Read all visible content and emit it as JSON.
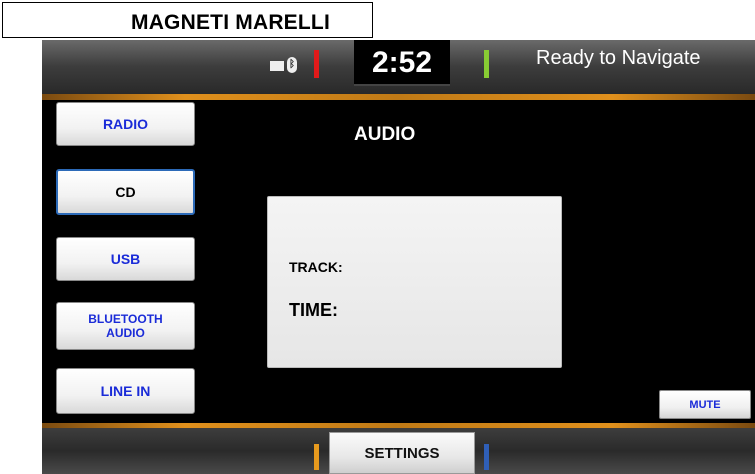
{
  "brand": {
    "name": "MAGNETI MARELLI"
  },
  "status_bar": {
    "clock": "2:52",
    "nav_status": "Ready to Navigate",
    "icons": [
      "mail-icon",
      "bluetooth-icon"
    ],
    "colors": {
      "left_indicator": "#e21a1a",
      "right_indicator": "#88cc33"
    }
  },
  "sources": [
    {
      "label": "RADIO",
      "active": false
    },
    {
      "label": "CD",
      "active": true
    },
    {
      "label": "USB",
      "active": false
    },
    {
      "label": "BLUETOOTH AUDIO",
      "active": false
    },
    {
      "label": "LINE IN",
      "active": false
    }
  ],
  "main": {
    "title": "AUDIO",
    "track_label": "TRACK:",
    "time_label": "TIME:",
    "mute_label": "MUTE"
  },
  "bottom_bar": {
    "settings_label": "SETTINGS",
    "colors": {
      "left_accent": "#e79a1e",
      "right_accent": "#2f5fb8"
    }
  },
  "colors": {
    "accent": "#e0901c",
    "button_text": "#1a2bd8",
    "active_border": "#2c6ab8"
  }
}
